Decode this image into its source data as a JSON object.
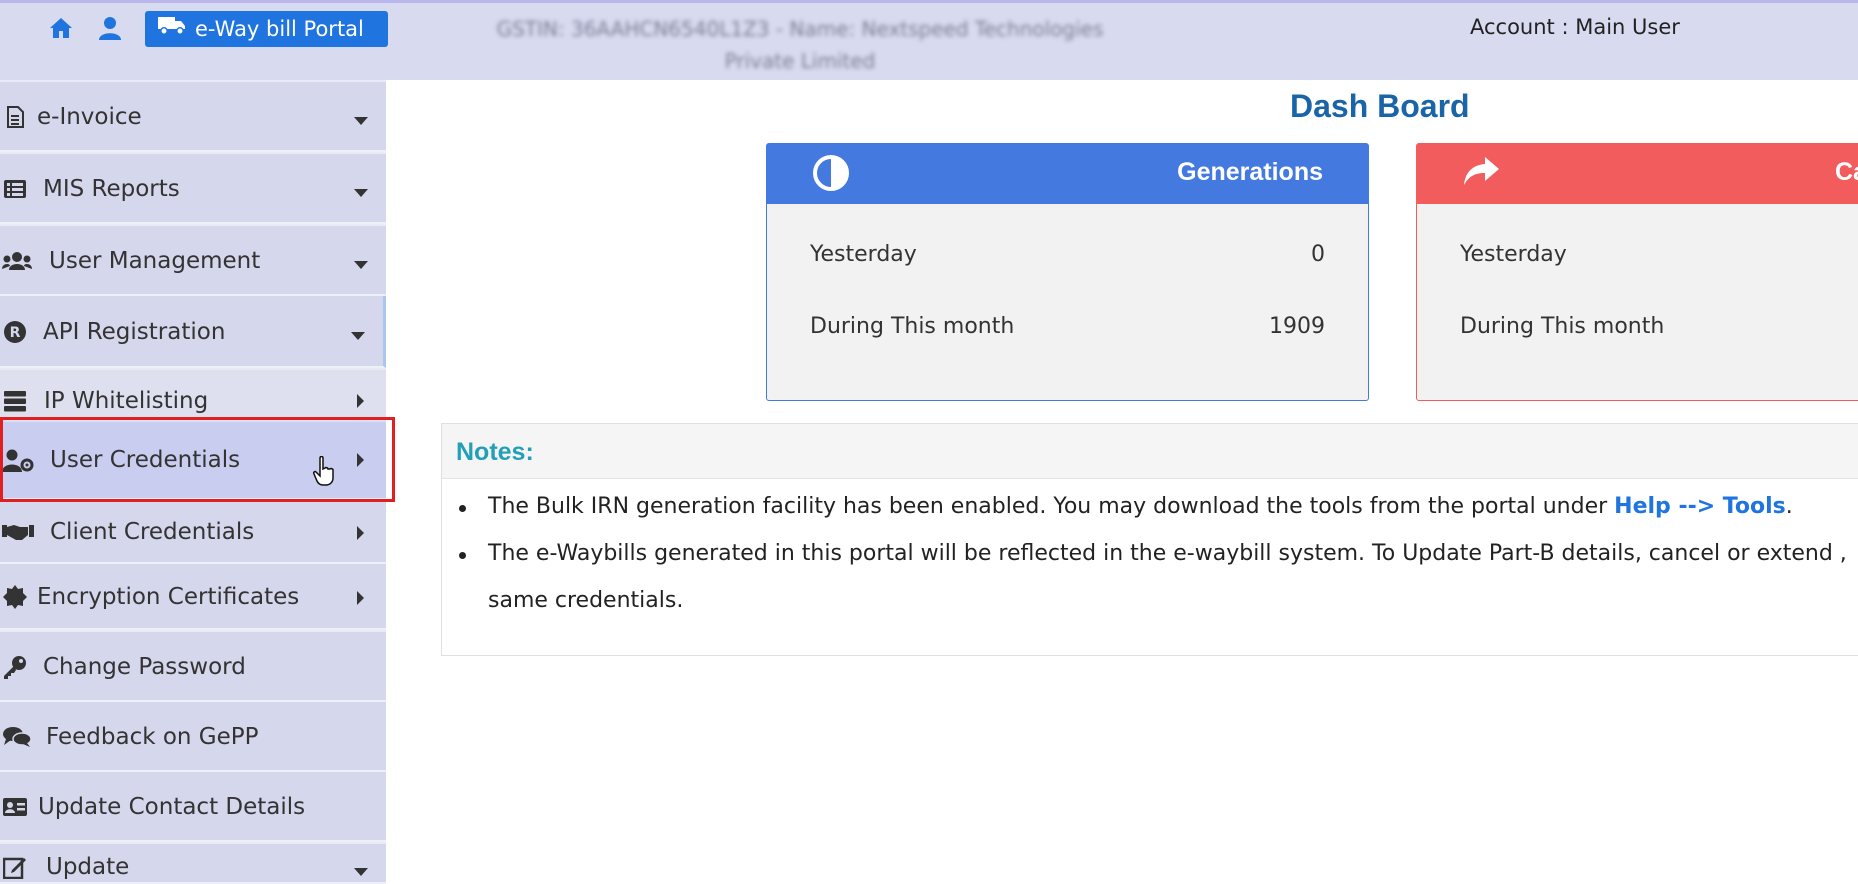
{
  "header": {
    "portal_button": "e-Way bill Portal",
    "gstin_line1": "GSTIN: 36AAHCN6540L1Z3 - Name: Nextspeed Technologies",
    "gstin_line2": "Private Limited",
    "account": "Account : Main User"
  },
  "sidebar": {
    "items": [
      {
        "label": "e-Invoice",
        "icon": "file-icon"
      },
      {
        "label": "MIS Reports",
        "icon": "list-icon"
      },
      {
        "label": "User Management",
        "icon": "users-icon"
      },
      {
        "label": "API Registration",
        "icon": "registered-icon"
      },
      {
        "label": "IP Whitelisting",
        "icon": "server-icon"
      },
      {
        "label": "User Credentials",
        "icon": "user-cog-icon"
      },
      {
        "label": "Client Credentials",
        "icon": "handshake-icon"
      },
      {
        "label": "Encryption Certificates",
        "icon": "certificate-icon"
      },
      {
        "label": "Change Password",
        "icon": "key-icon"
      },
      {
        "label": "Feedback on GePP",
        "icon": "comments-icon"
      },
      {
        "label": "Update Contact Details",
        "icon": "id-card-icon"
      },
      {
        "label": "Update",
        "icon": "edit-icon"
      }
    ]
  },
  "main": {
    "title": "Dash Board",
    "cards": [
      {
        "title": "Generations",
        "rows": [
          {
            "label": "Yesterday",
            "value": "0"
          },
          {
            "label": "During This month",
            "value": "1909"
          }
        ]
      },
      {
        "title": "Ca",
        "rows": [
          {
            "label": "Yesterday",
            "value": ""
          },
          {
            "label": "During This month",
            "value": ""
          }
        ]
      }
    ],
    "notes": {
      "title": "Notes:",
      "line1_text": "The Bulk IRN generation facility has been enabled. You may download the tools from the portal under ",
      "line1_link": "Help --> Tools",
      "line1_end": ".",
      "line2_text": "The e-Waybills generated in this portal will be reflected in the e-waybill system. To Update Part-B details, cancel or extend ,",
      "line3_text": "same credentials."
    }
  },
  "colors": {
    "topbar": "#d8daf0",
    "portal_button": "#1f74e0",
    "sidebar_item": "#d5d7ec",
    "card_generations": "#4479e0",
    "card_cancel": "#f25c5c",
    "title": "#1a64a8",
    "notes_title": "#23a0b8",
    "highlight": "#e02020"
  }
}
